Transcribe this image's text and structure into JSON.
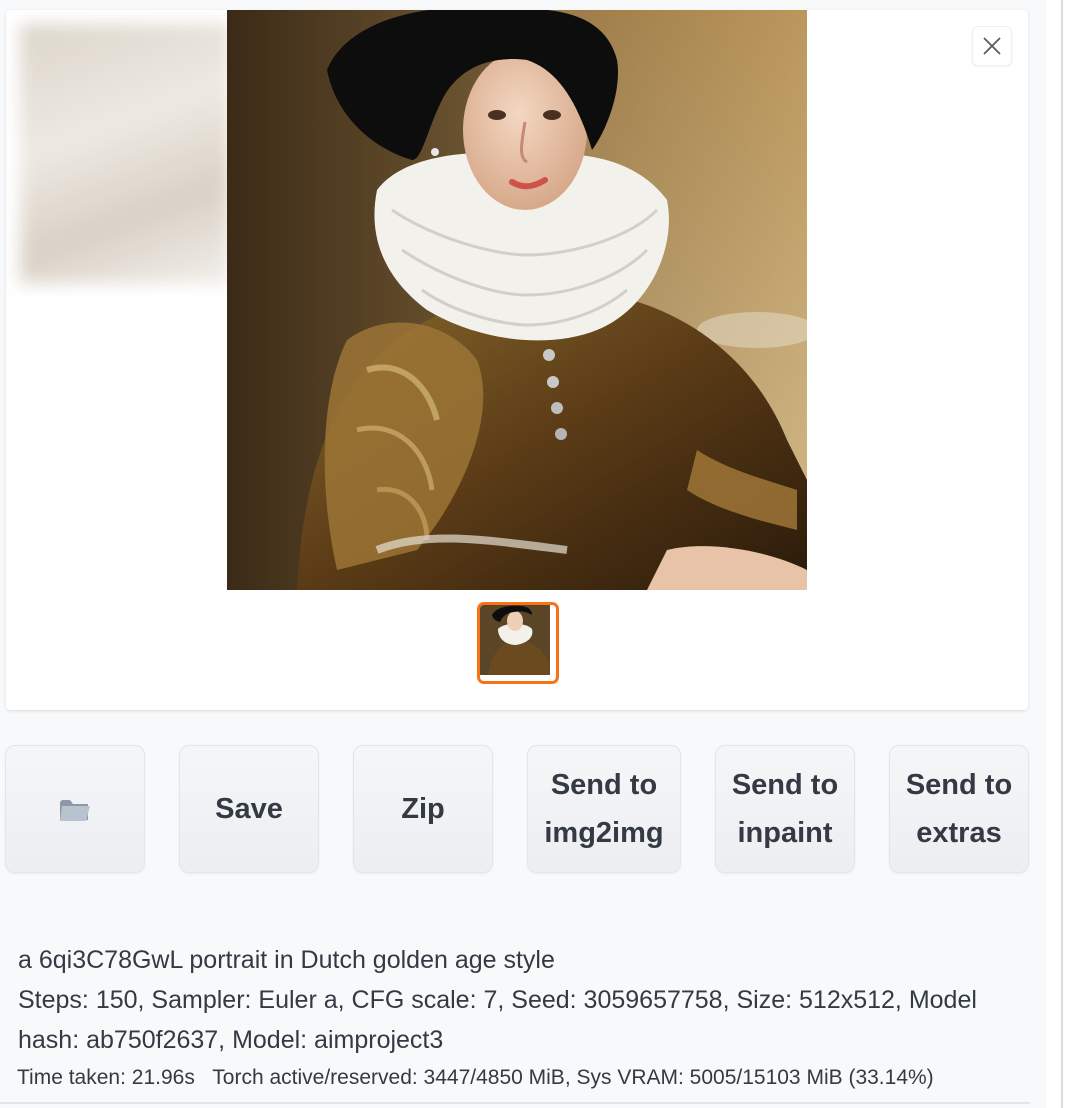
{
  "gallery": {
    "close_icon": "close-icon",
    "main_image": "generated-portrait",
    "thumbnail": "generated-portrait-thumbnail",
    "thumbnail_border_color": "#f97316"
  },
  "actions": {
    "folder_icon": "folder-icon",
    "save_label": "Save",
    "zip_label": "Zip",
    "img2img_label": "Send to\nimg2img",
    "inpaint_label": "Send to\ninpaint",
    "extras_label": "Send to\nextras"
  },
  "generation_info": {
    "prompt": "a 6qi3C78GwL portrait in Dutch golden age style",
    "parameters": "Steps: 150, Sampler: Euler a, CFG scale: 7, Seed: 3059657758, Size: 512x512, Model hash: ab750f2637, Model: aimproject3",
    "time_taken": "Time taken: 21.96s",
    "memory": "Torch active/reserved: 3447/4850 MiB, Sys VRAM: 5005/15103 MiB (33.14%)"
  }
}
